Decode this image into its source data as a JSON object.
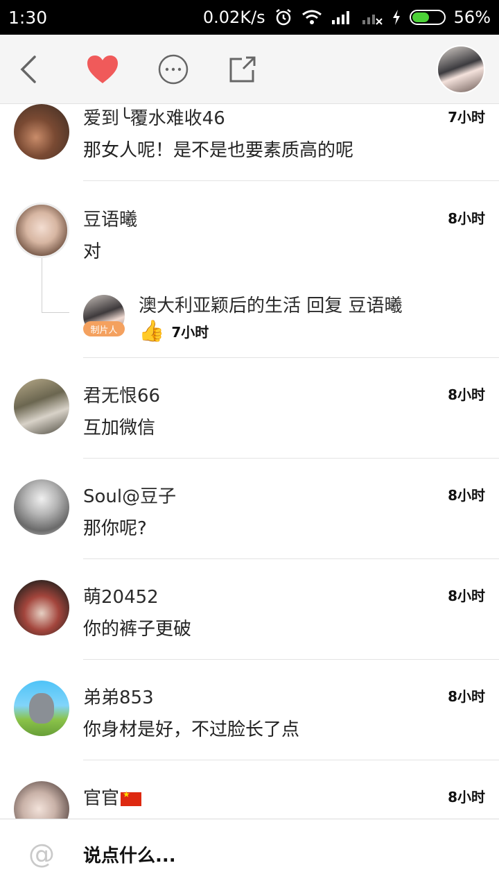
{
  "status_bar": {
    "time": "1:30",
    "speed": "0.02K/s",
    "battery": "56%",
    "battery_level": 0.56
  },
  "toolbar": {
    "back_icon": "chevron-left-icon",
    "like_icon": "heart-icon",
    "more_icon": "more-icon",
    "share_icon": "share-icon"
  },
  "comments": [
    {
      "name": "爱到╰覆水难收46",
      "time": "7小时",
      "text": "那女人呢！是不是也要素质高的呢"
    },
    {
      "name": "豆语曦",
      "time": "8小时",
      "text": "对",
      "reply": {
        "text": "澳大利亚颖后的生活  回复  豆语曦",
        "badge": "制片人",
        "time": "7小时"
      }
    },
    {
      "name": "君无恨66",
      "time": "8小时",
      "text": "互加微信"
    },
    {
      "name": "Soul@豆子",
      "time": "8小时",
      "text": "那你呢?"
    },
    {
      "name": "萌20452",
      "time": "8小时",
      "text": "你的裤子更破"
    },
    {
      "name": "弟弟853",
      "time": "8小时",
      "text": "你身材是好，不过脸长了点"
    },
    {
      "name": "官官",
      "time": "8小时",
      "text": ""
    }
  ],
  "input": {
    "placeholder": "说点什么...",
    "at_symbol": "@"
  },
  "colors": {
    "accent_heart": "#f05a5a",
    "badge": "#f4a15f",
    "battery": "#4cd137"
  }
}
